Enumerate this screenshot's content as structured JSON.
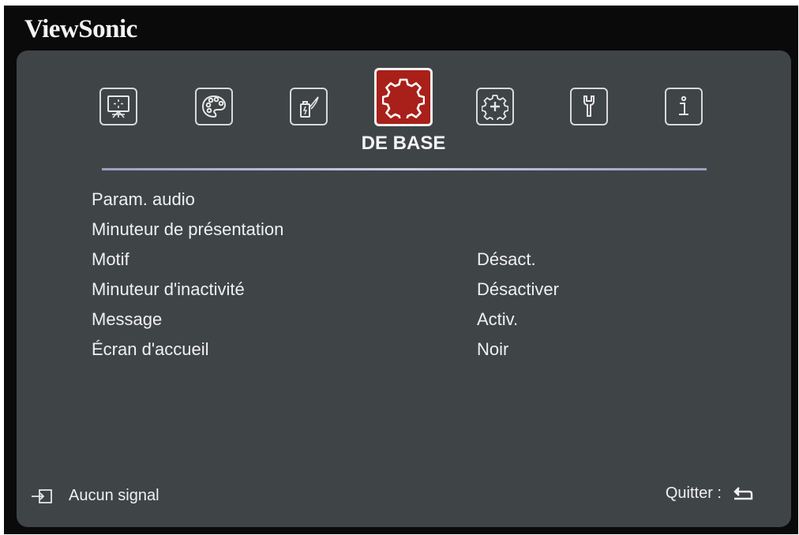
{
  "brand": "ViewSonic",
  "tabs": [
    {
      "icon": "screen-icon",
      "active": false
    },
    {
      "icon": "palette-icon",
      "active": false
    },
    {
      "icon": "power-battery-icon",
      "active": false
    },
    {
      "icon": "gear-icon",
      "active": true
    },
    {
      "icon": "advanced-gear-icon",
      "active": false
    },
    {
      "icon": "wrench-icon",
      "active": false
    },
    {
      "icon": "info-icon",
      "active": false
    }
  ],
  "active_tab_label": "DE BASE",
  "menu": {
    "items": [
      {
        "label": "Param. audio",
        "value": ""
      },
      {
        "label": "Minuteur de présentation",
        "value": ""
      },
      {
        "label": "Motif",
        "value": "Désact."
      },
      {
        "label": "Minuteur d'inactivité",
        "value": "Désactiver"
      },
      {
        "label": "Message",
        "value": "Activ."
      },
      {
        "label": "Écran d'accueil",
        "value": "Noir"
      }
    ]
  },
  "footer": {
    "signal_text": "Aucun signal",
    "quit_text": "Quitter :"
  },
  "colors": {
    "panel": "#3f4447",
    "active_tab": "#a82019",
    "text": "#f0f0f0"
  }
}
